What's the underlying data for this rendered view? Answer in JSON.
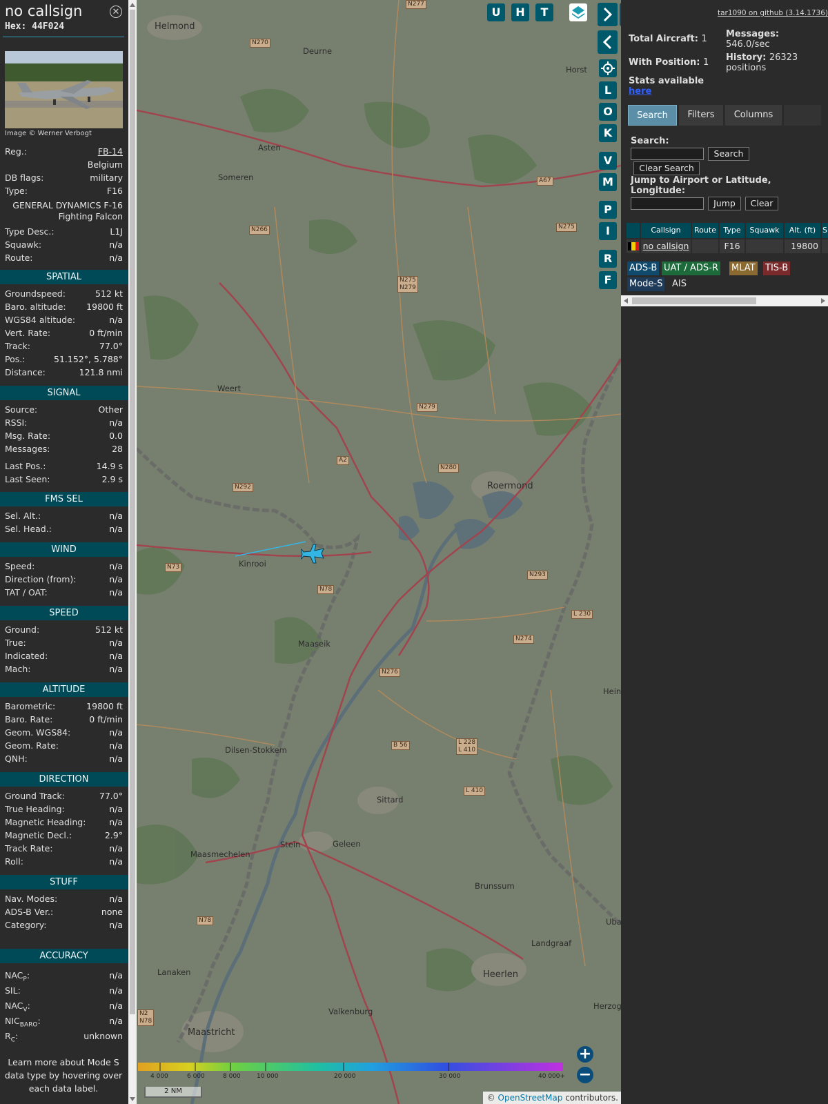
{
  "info": {
    "callsign": "no callsign",
    "hex_line": "Hex: 44F024",
    "photo_credit": "Image © Werner Verbogt",
    "fields": [
      {
        "k": "Reg.:",
        "v": "FB-14"
      },
      {
        "k": "",
        "v": "Belgium"
      },
      {
        "k": "DB flags:",
        "v": "military"
      },
      {
        "k": "Type:",
        "v": "F16"
      }
    ],
    "type_full_1": "GENERAL DYNAMICS F-16",
    "type_full_2": "Fighting Falcon",
    "fields2": [
      {
        "k": "Type Desc.:",
        "v": "L1J"
      },
      {
        "k": "Squawk:",
        "v": "n/a"
      },
      {
        "k": "Route:",
        "v": "n/a"
      }
    ],
    "spatial": {
      "title": "SPATIAL",
      "rows": [
        {
          "k": "Groundspeed:",
          "v": "512 kt"
        },
        {
          "k": "Baro. altitude:",
          "v": "19800 ft"
        },
        {
          "k": "WGS84 altitude:",
          "v": "n/a"
        },
        {
          "k": "Vert. Rate:",
          "v": "0 ft/min"
        },
        {
          "k": "Track:",
          "v": "77.0°"
        },
        {
          "k": "Pos.:",
          "v": "51.152°, 5.788°"
        },
        {
          "k": "Distance:",
          "v": "121.8 nmi"
        }
      ]
    },
    "signal": {
      "title": "SIGNAL",
      "rows": [
        {
          "k": "Source:",
          "v": "Other"
        },
        {
          "k": "RSSI:",
          "v": "n/a"
        },
        {
          "k": "Msg. Rate:",
          "v": "0.0"
        },
        {
          "k": "Messages:",
          "v": "28"
        },
        {
          "k": "Last Pos.:",
          "v": "14.9 s"
        },
        {
          "k": "Last Seen:",
          "v": "2.9 s"
        }
      ]
    },
    "fmssel": {
      "title": "FMS SEL",
      "rows": [
        {
          "k": "Sel. Alt.:",
          "v": "n/a"
        },
        {
          "k": "Sel. Head.:",
          "v": "n/a"
        }
      ]
    },
    "wind": {
      "title": "WIND",
      "rows": [
        {
          "k": "Speed:",
          "v": "n/a"
        },
        {
          "k": "Direction (from):",
          "v": "n/a"
        },
        {
          "k": "TAT / OAT:",
          "v": "n/a"
        }
      ]
    },
    "speed": {
      "title": "SPEED",
      "rows": [
        {
          "k": "Ground:",
          "v": "512 kt"
        },
        {
          "k": "True:",
          "v": "n/a"
        },
        {
          "k": "Indicated:",
          "v": "n/a"
        },
        {
          "k": "Mach:",
          "v": "n/a"
        }
      ]
    },
    "altitude": {
      "title": "ALTITUDE",
      "rows": [
        {
          "k": "Barometric:",
          "v": "19800 ft"
        },
        {
          "k": "Baro. Rate:",
          "v": "0 ft/min"
        },
        {
          "k": "Geom. WGS84:",
          "v": "n/a"
        },
        {
          "k": "Geom. Rate:",
          "v": "n/a"
        },
        {
          "k": "QNH:",
          "v": "n/a"
        }
      ]
    },
    "direction": {
      "title": "DIRECTION",
      "rows": [
        {
          "k": "Ground Track:",
          "v": "77.0°"
        },
        {
          "k": "True Heading:",
          "v": "n/a"
        },
        {
          "k": "Magnetic Heading:",
          "v": "n/a"
        },
        {
          "k": "Magnetic Decl.:",
          "v": "2.9°"
        },
        {
          "k": "Track Rate:",
          "v": "n/a"
        },
        {
          "k": "Roll:",
          "v": "n/a"
        }
      ]
    },
    "stuff": {
      "title": "STUFF",
      "rows": [
        {
          "k": "Nav. Modes:",
          "v": "n/a"
        },
        {
          "k": "ADS-B Ver.:",
          "v": "none"
        },
        {
          "k": "Category:",
          "v": "n/a"
        }
      ]
    },
    "accuracy": {
      "title": "ACCURACY",
      "rows": [
        {
          "k": "NAC",
          "sub": "P",
          "v": "n/a"
        },
        {
          "k": "SIL:",
          "sub": "",
          "v": "n/a"
        },
        {
          "k": "NAC",
          "sub": "V",
          "v": "n/a"
        },
        {
          "k": "NIC",
          "sub": "BARO",
          "v": "n/a"
        },
        {
          "k": "R",
          "sub": "C",
          "v": "unknown"
        }
      ]
    },
    "footer_1": "Learn more about Mode S",
    "footer_2": "data type by hovering over",
    "footer_3": "each data label."
  },
  "map": {
    "buttons_top": [
      "U",
      "H",
      "T"
    ],
    "buttons_side": [
      "L",
      "O",
      "K",
      "V",
      "M",
      "P",
      "I",
      "R",
      "F"
    ],
    "places": [
      {
        "name": "Helmond"
      },
      {
        "name": "Deurne"
      },
      {
        "name": "Horst"
      },
      {
        "name": "Asten"
      },
      {
        "name": "Someren"
      },
      {
        "name": "Weert"
      },
      {
        "name": "Roermond"
      },
      {
        "name": "Kinrooi"
      },
      {
        "name": "Maaseik"
      },
      {
        "name": "Dilsen-Stokkem"
      },
      {
        "name": "Sittard"
      },
      {
        "name": "Stein"
      },
      {
        "name": "Geleen"
      },
      {
        "name": "Maasmechelen"
      },
      {
        "name": "Brunssum"
      },
      {
        "name": "Landgraaf"
      },
      {
        "name": "Heerlen"
      },
      {
        "name": "Lanaken"
      },
      {
        "name": "Valkenburg"
      },
      {
        "name": "Maastricht"
      },
      {
        "name": "Hein"
      },
      {
        "name": "Herzog"
      },
      {
        "name": "Uba"
      }
    ],
    "roads": [
      "N270",
      "N277",
      "N266",
      "N275",
      "N275\nN279",
      "N279",
      "N280",
      "A2",
      "N292",
      "N73",
      "N78",
      "N293",
      "L 230",
      "N274",
      "N276",
      "B 56",
      "L 228\nL 410",
      "L 410",
      "A67",
      "N78",
      "N2\nN78"
    ],
    "legend": [
      "4 000",
      "6 000",
      "8 000",
      "10 000",
      "20 000",
      "30 000",
      "40 000+"
    ],
    "scale_label": "2 NM",
    "attribution_pre": "© ",
    "attribution_link": "OpenStreetMap",
    "attribution_post": " contributors."
  },
  "side": {
    "github": "tar1090 on github (3.14.1736)",
    "total_label": "Total Aircraft:",
    "total_value": "1",
    "withpos_label": "With Position:",
    "withpos_value": "1",
    "messages_label": "Messages:",
    "messages_value": "546.0/sec",
    "history_label": "History:",
    "history_value": "26323",
    "history_unit": "positions",
    "stats_label": "Stats available",
    "stats_link": "here",
    "tabs": [
      "Search",
      "Filters",
      "Columns"
    ],
    "search_label": "Search:",
    "search_button": "Search",
    "clear_search_button": "Clear Search",
    "jump_label_1": "Jump to Airport or Latitude,",
    "jump_label_2": "Longitude:",
    "jump_button": "Jump",
    "clear_button": "Clear",
    "table_headers": [
      "Callsign",
      "Route",
      "Type",
      "Squawk",
      "Alt. (ft)",
      "S"
    ],
    "table_row": {
      "callsign": "no callsign",
      "route": "",
      "type": "F16",
      "squawk": "",
      "alt": "19800"
    },
    "chips": [
      "ADS-B",
      "UAT / ADS-R",
      "MLAT",
      "TIS-B",
      "Mode-S",
      "AIS"
    ]
  }
}
